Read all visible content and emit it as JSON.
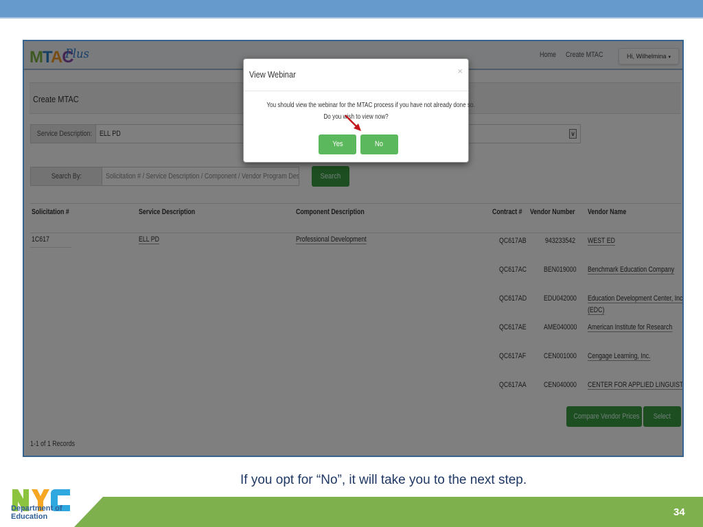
{
  "slide": {
    "caption": "If you opt for “No”, it will take you to the next step.",
    "page_number": "34",
    "logo": {
      "letters": "NYC",
      "line1": "Department of",
      "line2": "Education"
    },
    "colors": {
      "top_band": "#6699cc",
      "green_band": "#7eb04d",
      "caption": "#1f3864"
    }
  },
  "app": {
    "logo": {
      "m": "M",
      "t": "T",
      "a": "A",
      "c": "C",
      "plus": "Plus"
    },
    "nav": {
      "home": "Home",
      "create": "Create MTAC",
      "user": "Hi, Wilhelmina",
      "user_caret": "▾"
    },
    "page_title": "Create MTAC",
    "service_description": {
      "label": "Service Description:",
      "value": "ELL PD",
      "arrow": "∨"
    },
    "search": {
      "label": "Search By:",
      "placeholder": "Solicitation # / Service Description / Component / Vendor Program Description",
      "button": "Search"
    },
    "table": {
      "headers": [
        "Solicitation #",
        "Service Description",
        "Component Description",
        "Contract #",
        "Vendor Number",
        "Vendor Name"
      ],
      "solicitation": "1C617",
      "service_description": "ELL PD",
      "component_description": "Professional Development",
      "vendors": [
        {
          "contract": "QC617AB",
          "number": "943233542",
          "name": "WEST ED",
          "name2": ""
        },
        {
          "contract": "QC617AC",
          "number": "BEN019000",
          "name": "Benchmark Education Company",
          "name2": ""
        },
        {
          "contract": "QC617AD",
          "number": "EDU042000",
          "name": "Education Development Center, Inc.",
          "name2": "(EDC)"
        },
        {
          "contract": "QC617AE",
          "number": "AME040000",
          "name": "American Institute for Research",
          "name2": ""
        },
        {
          "contract": "QC617AF",
          "number": "CEN001000",
          "name": "Cengage Learning, Inc.",
          "name2": ""
        },
        {
          "contract": "QC617AA",
          "number": "CEN040000",
          "name": "CENTER FOR APPLIED LINGUISTICS",
          "name2": ""
        }
      ]
    },
    "buttons": {
      "compare": "Compare Vendor Prices",
      "select": "Select"
    },
    "records": "1-1 of 1 Records"
  },
  "modal": {
    "title": "View Webinar",
    "close": "×",
    "line1": "You should view the webinar for the MTAC process if you have not already done so.",
    "line2": "Do you wish to view now?",
    "yes": "Yes",
    "no": "No"
  }
}
